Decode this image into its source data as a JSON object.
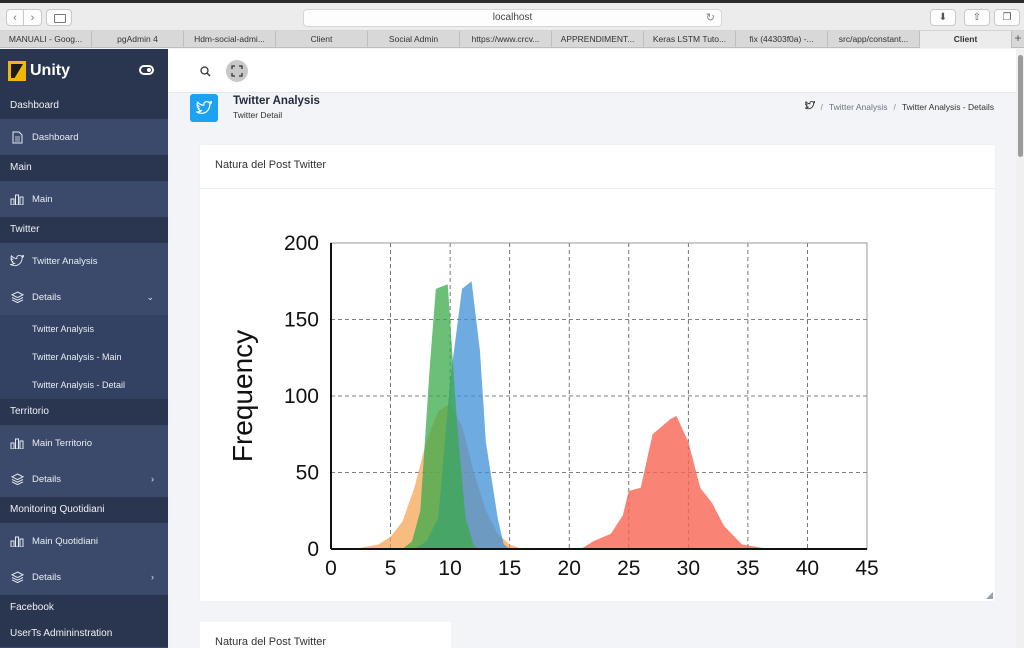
{
  "browser": {
    "url": "localhost",
    "tabs": [
      {
        "label": "MANUALI - Goog..."
      },
      {
        "label": "pgAdmin 4"
      },
      {
        "label": "Hdm-social-admi..."
      },
      {
        "label": "Client"
      },
      {
        "label": "Social Admin"
      },
      {
        "label": "https://www.crcv..."
      },
      {
        "label": "APPRENDIMENT..."
      },
      {
        "label": "Keras LSTM Tuto..."
      },
      {
        "label": "fix (44303f0a) -..."
      },
      {
        "label": "src/app/constant..."
      },
      {
        "label": "Client"
      }
    ]
  },
  "sidebar": {
    "brand": "Unity",
    "sections": {
      "dashboard": "Dashboard",
      "main": "Main",
      "twitter": "Twitter",
      "territorio": "Territorio",
      "monitoring": "Monitoring Quotidiani",
      "facebook": "Facebook",
      "users": "UserTs Admininstration"
    },
    "items": {
      "dashboard": "Dashboard",
      "main": "Main",
      "twitter_analysis": "Twitter Analysis",
      "details": "Details",
      "sub_twitter_analysis": "Twitter Analysis",
      "sub_twitter_analysis_main": "Twitter Analysis - Main",
      "sub_twitter_analysis_detail": "Twitter Analysis - Detail",
      "main_territorio": "Main Territorio",
      "details_territorio": "Details",
      "main_quotidiani": "Main Quotidiani",
      "details_quotidiani": "Details"
    }
  },
  "page": {
    "title": "Twitter Analysis",
    "subtitle": "Twitter Detail",
    "breadcrumb": {
      "parent": "Twitter Analysis",
      "current": "Twitter Analysis - Details"
    }
  },
  "cards": {
    "card1_title": "Natura del Post Twitter",
    "card2_title": "Natura del Post Twitter"
  },
  "chart_data": {
    "type": "area",
    "ylabel": "Frequency",
    "xlim": [
      0,
      45
    ],
    "ylim": [
      0,
      200
    ],
    "xticks": [
      0,
      5,
      10,
      15,
      20,
      25,
      30,
      35,
      40,
      45
    ],
    "yticks": [
      0,
      50,
      100,
      150,
      200
    ],
    "grid": "dashed",
    "series": [
      {
        "color": "#f5a04a",
        "opacity": 0.7,
        "points": [
          [
            2,
            0
          ],
          [
            4,
            3
          ],
          [
            5,
            8
          ],
          [
            6,
            18
          ],
          [
            7,
            40
          ],
          [
            8,
            70
          ],
          [
            9,
            90
          ],
          [
            10,
            95
          ],
          [
            11,
            80
          ],
          [
            12,
            50
          ],
          [
            13,
            25
          ],
          [
            14,
            10
          ],
          [
            15,
            3
          ],
          [
            16,
            0
          ]
        ]
      },
      {
        "color": "#3d8fd6",
        "opacity": 0.75,
        "points": [
          [
            7,
            0
          ],
          [
            8,
            5
          ],
          [
            9,
            20
          ],
          [
            10,
            110
          ],
          [
            11,
            170
          ],
          [
            11.8,
            175
          ],
          [
            12.5,
            130
          ],
          [
            13,
            70
          ],
          [
            14,
            20
          ],
          [
            14.5,
            3
          ],
          [
            15,
            0
          ]
        ]
      },
      {
        "color": "#3ba94a",
        "opacity": 0.75,
        "points": [
          [
            6,
            0
          ],
          [
            6.8,
            5
          ],
          [
            7.5,
            25
          ],
          [
            8.3,
            120
          ],
          [
            8.8,
            170
          ],
          [
            9.8,
            173
          ],
          [
            10.6,
            80
          ],
          [
            11.3,
            20
          ],
          [
            12,
            2
          ],
          [
            12.5,
            0
          ]
        ]
      },
      {
        "color": "#f76452",
        "opacity": 0.8,
        "points": [
          [
            21,
            0
          ],
          [
            22,
            5
          ],
          [
            23.5,
            10
          ],
          [
            24.5,
            22
          ],
          [
            25,
            38
          ],
          [
            26,
            40
          ],
          [
            27,
            75
          ],
          [
            28.5,
            85
          ],
          [
            29,
            87
          ],
          [
            30,
            70
          ],
          [
            31,
            40
          ],
          [
            32,
            30
          ],
          [
            33,
            15
          ],
          [
            34.5,
            3
          ],
          [
            36,
            1
          ],
          [
            37,
            0
          ]
        ]
      }
    ]
  }
}
